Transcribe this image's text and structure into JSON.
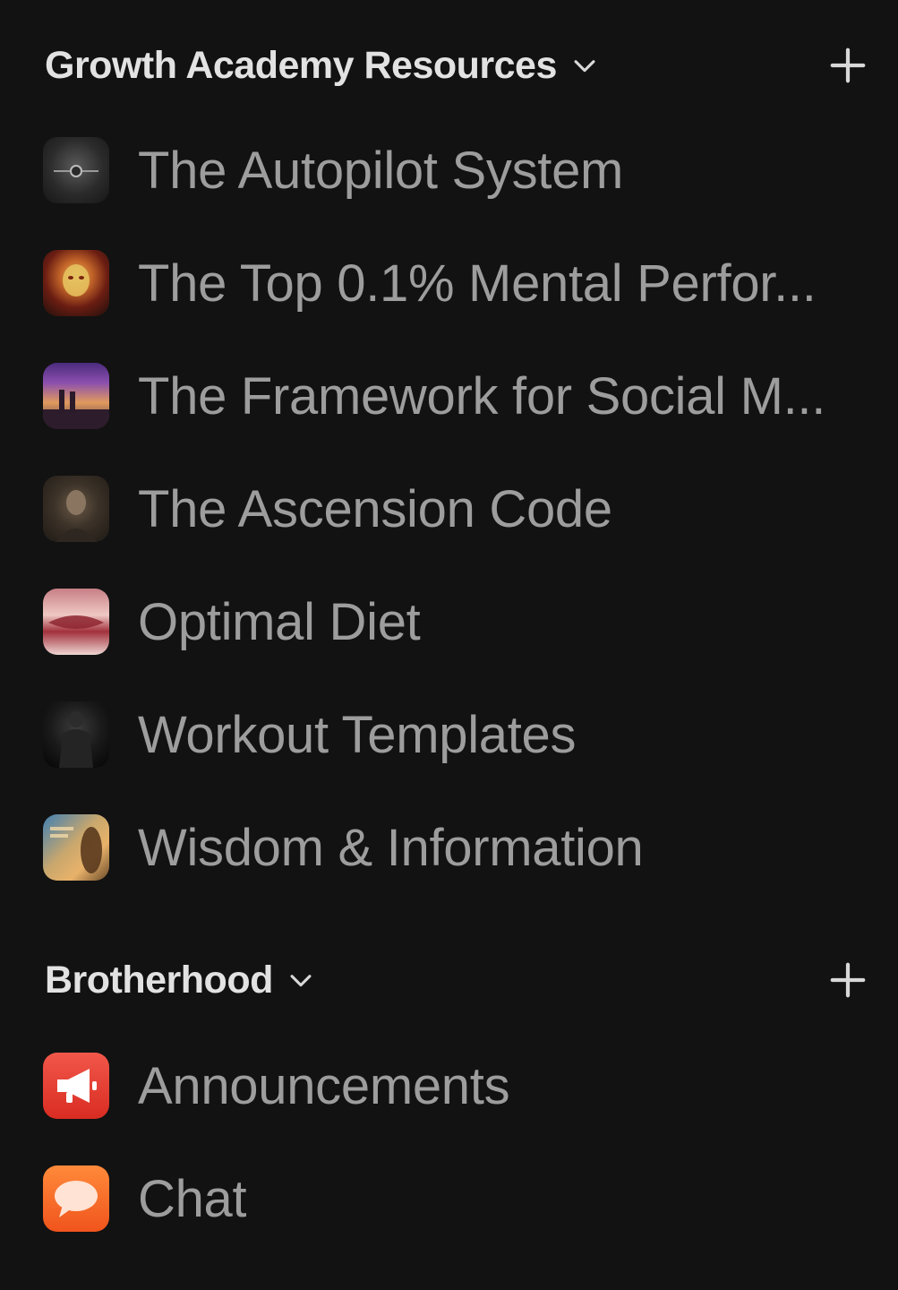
{
  "sections": [
    {
      "title": "Growth Academy Resources",
      "items": [
        {
          "label": "The Autopilot System",
          "icon": "autopilot-thumbnail"
        },
        {
          "label": "The Top 0.1% Mental Perfor...",
          "icon": "mental-performance-thumbnail"
        },
        {
          "label": "The Framework for Social M...",
          "icon": "social-framework-thumbnail"
        },
        {
          "label": "The Ascension Code",
          "icon": "ascension-code-thumbnail"
        },
        {
          "label": "Optimal Diet",
          "icon": "optimal-diet-thumbnail"
        },
        {
          "label": "Workout Templates",
          "icon": "workout-templates-thumbnail"
        },
        {
          "label": "Wisdom & Information",
          "icon": "wisdom-information-thumbnail"
        }
      ]
    },
    {
      "title": "Brotherhood",
      "items": [
        {
          "label": "Announcements",
          "icon": "megaphone-icon"
        },
        {
          "label": "Chat",
          "icon": "speech-bubble-icon"
        }
      ]
    }
  ],
  "colors": {
    "background": "#121212",
    "header_text": "#e2e2e2",
    "item_text": "#9d9d9d",
    "announcements_accent": "#e3372b",
    "chat_accent": "#f5641f"
  }
}
